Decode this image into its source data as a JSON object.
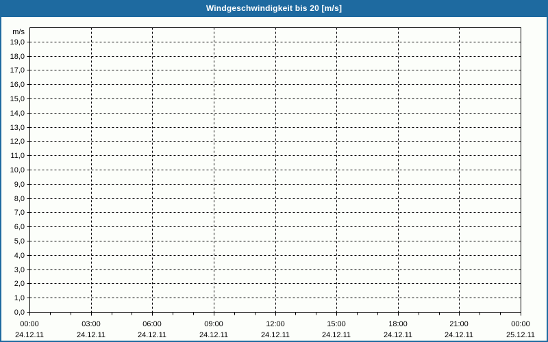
{
  "header": {
    "title": "Windgeschwindigkeit bis 20 [m/s]"
  },
  "colors": {
    "titlebar_bg": "#1E6AA0",
    "titlebar_text": "#FFFFFF",
    "frame_border": "#1E6AA0",
    "page_bg": "#FCFEFA",
    "plot_border": "#000000",
    "grid": "#000000",
    "tick_text": "#000000"
  },
  "chart_data": {
    "type": "line",
    "title": "Windgeschwindigkeit bis 20 [m/s]",
    "ylabel": "m/s",
    "ylim": [
      0,
      20
    ],
    "grid": "dashed",
    "legend": null,
    "series": [],
    "y_ticks": [
      {
        "value": 0,
        "label": "0,0"
      },
      {
        "value": 1,
        "label": "1,0"
      },
      {
        "value": 2,
        "label": "2,0"
      },
      {
        "value": 3,
        "label": "3,0"
      },
      {
        "value": 4,
        "label": "4,0"
      },
      {
        "value": 5,
        "label": "5,0"
      },
      {
        "value": 6,
        "label": "6,0"
      },
      {
        "value": 7,
        "label": "7,0"
      },
      {
        "value": 8,
        "label": "8,0"
      },
      {
        "value": 9,
        "label": "9,0"
      },
      {
        "value": 10,
        "label": "10,0"
      },
      {
        "value": 11,
        "label": "11,0"
      },
      {
        "value": 12,
        "label": "12,0"
      },
      {
        "value": 13,
        "label": "13,0"
      },
      {
        "value": 14,
        "label": "14,0"
      },
      {
        "value": 15,
        "label": "15,0"
      },
      {
        "value": 16,
        "label": "16,0"
      },
      {
        "value": 17,
        "label": "17,0"
      },
      {
        "value": 18,
        "label": "18,0"
      },
      {
        "value": 19,
        "label": "19,0"
      }
    ],
    "x_axis": {
      "range_hours": [
        0,
        24
      ],
      "minor_tick_every_hours": 1,
      "major_tick_every_hours": 3,
      "major_ticks": [
        {
          "hour": 0,
          "time": "00:00",
          "date": "24.12.11"
        },
        {
          "hour": 3,
          "time": "03:00",
          "date": "24.12.11"
        },
        {
          "hour": 6,
          "time": "06:00",
          "date": "24.12.11"
        },
        {
          "hour": 9,
          "time": "09:00",
          "date": "24.12.11"
        },
        {
          "hour": 12,
          "time": "12:00",
          "date": "24.12.11"
        },
        {
          "hour": 15,
          "time": "15:00",
          "date": "24.12.11"
        },
        {
          "hour": 18,
          "time": "18:00",
          "date": "24.12.11"
        },
        {
          "hour": 21,
          "time": "21:00",
          "date": "24.12.11"
        },
        {
          "hour": 24,
          "time": "00:00",
          "date": "25.12.11"
        }
      ]
    }
  }
}
